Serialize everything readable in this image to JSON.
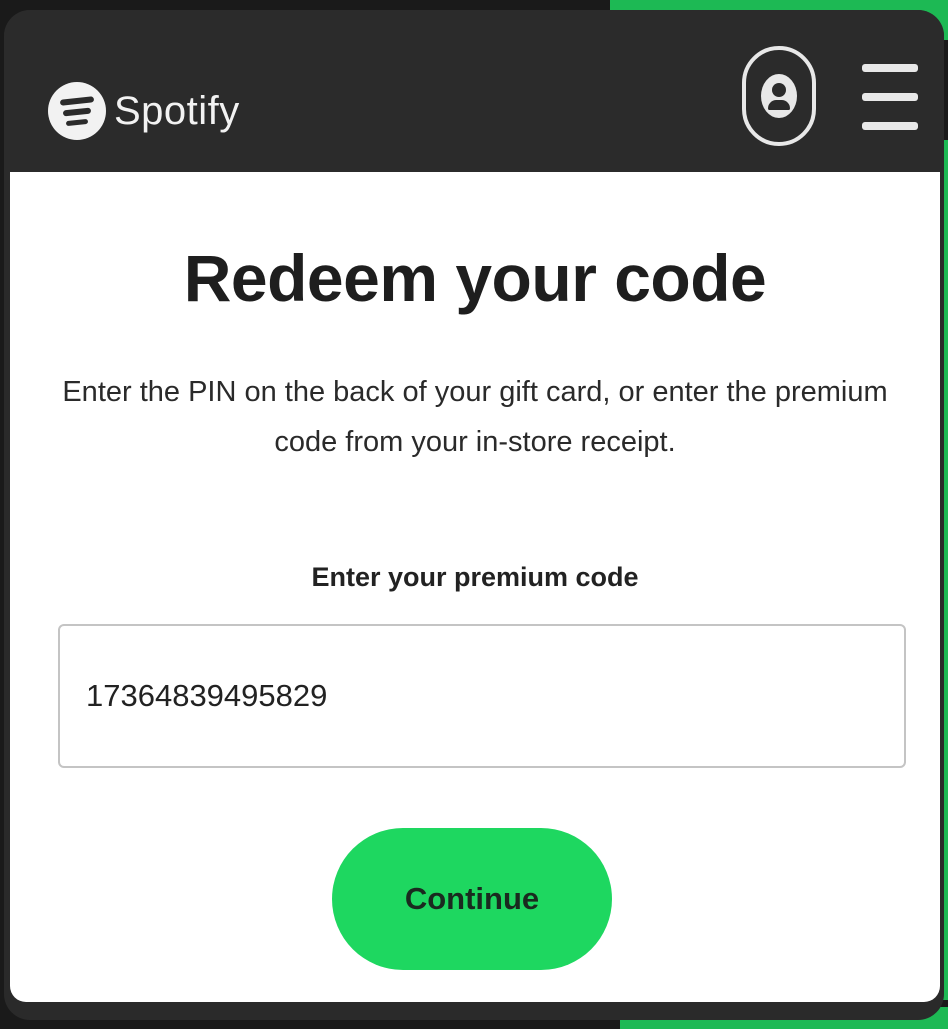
{
  "header": {
    "brand_name": "Spotify",
    "logo_icon": "spotify-logo-icon",
    "profile_icon": "user-profile-icon",
    "menu_icon": "hamburger-menu-icon"
  },
  "main": {
    "title": "Redeem your code",
    "description": "Enter the PIN on the back of your gift card, or enter the premium code from your in-store receipt.",
    "field_label": "Enter your premium code",
    "code_value": "17364839495829",
    "continue_label": "Continue"
  },
  "colors": {
    "brand_green": "#1ed760",
    "header_bg": "#2b2b2b",
    "card_bg": "#ffffff"
  }
}
